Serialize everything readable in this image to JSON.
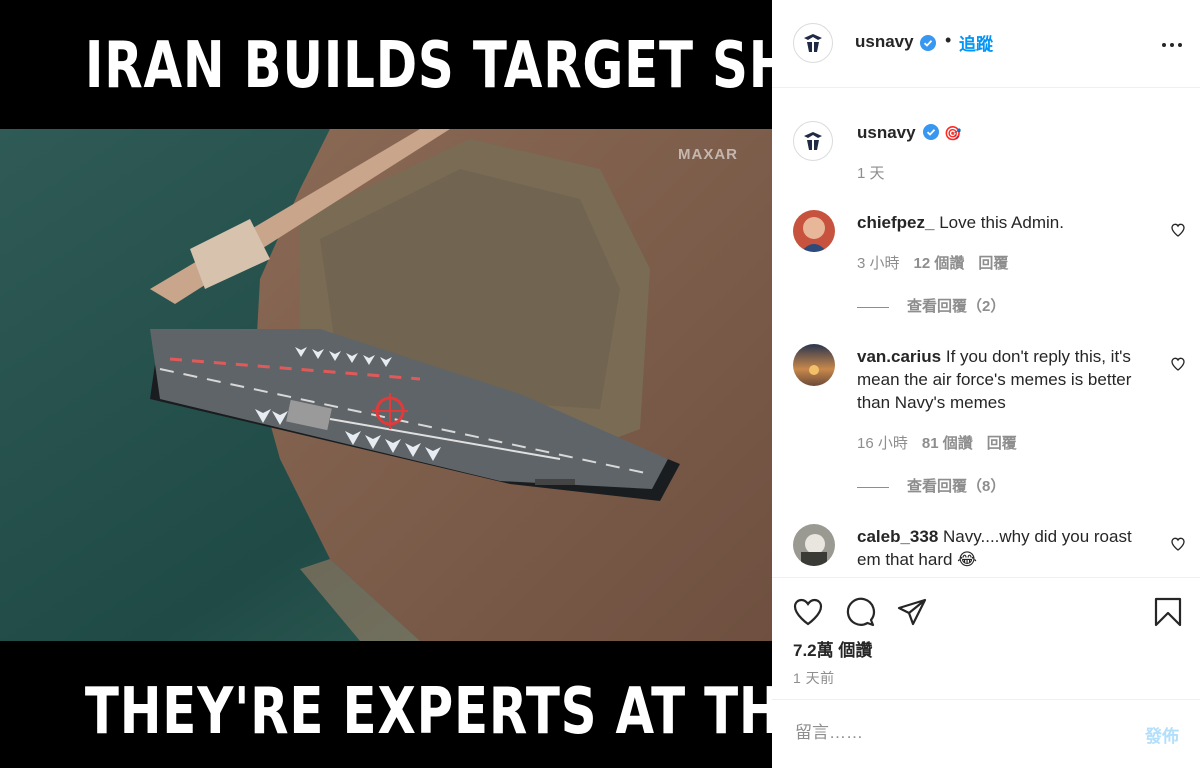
{
  "meme": {
    "top_text": "IRAN BUILDS TARGET SHIP",
    "bottom_text": "THEY'RE EXPERTS AT THAT",
    "watermark": "MAXAR"
  },
  "header": {
    "username": "usnavy",
    "dot": "•",
    "follow_label": "追蹤"
  },
  "caption": {
    "username": "usnavy",
    "emoji": "🎯",
    "time": "1 天"
  },
  "comments": [
    {
      "username": "chiefpez_",
      "text": "Love this Admin.",
      "time": "3 小時",
      "likes": "12 個讚",
      "reply": "回覆",
      "view_replies": "查看回覆（2）"
    },
    {
      "username": "van.carius",
      "text": "If you don't reply this, it's mean the air force's memes is better than Navy's memes",
      "time": "16 小時",
      "likes": "81 個讚",
      "reply": "回覆",
      "view_replies": "查看回覆（8）"
    },
    {
      "username": "caleb_338",
      "text": "Navy....why did you roast em that hard 😂"
    }
  ],
  "actions": {
    "likes": "7.2萬 個讚",
    "time": "1 天前"
  },
  "comment_box": {
    "placeholder": "留言……",
    "post_label": "發佈"
  },
  "colors": {
    "accent": "#0095f6",
    "verified": "#3897f0",
    "muted": "#8e8e8e",
    "text": "#262626"
  }
}
